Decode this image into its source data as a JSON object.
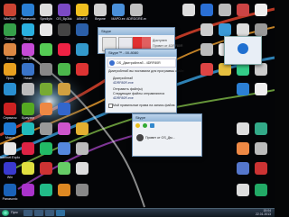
{
  "desktop": {
    "top_labels": [
      "WinRAR",
      "Panasonic",
      "Sprcliyin",
      "OS_Bp3kk",
      "АбЫЕЕ",
      "Внукне",
      "MAPD.ex",
      "ADRDGRE.exe"
    ],
    "left_labels": [
      "Google",
      "Skype",
      "Фото",
      "Camping",
      "Проч",
      "Ниже",
      "Сервисы",
      "Браузер",
      "Мэтот",
      "Internet Explorer",
      "Win",
      "Panasonic"
    ]
  },
  "main_window": {
    "title": "Skype™ - 00-8080",
    "conversation_title": "OS_Дмитрийлтаб - 4DRF80R",
    "line1": "Дмитрийлтаб вы поставили для программы скайп",
    "line2": "Дмитрийлтаб",
    "line3": "4DRF80R.exe",
    "line4": "Отправить файл(ы)",
    "line5": "Следующие файлы отправляются",
    "line6": "4DRF80R.exe",
    "checkbox_label": "Мой правильные права на запись файла"
  },
  "popup_window": {
    "title": "Skype",
    "status": "Доступен",
    "contact": "Привет от 4DRF80R"
  },
  "contact_panel": {
    "title": "Skype",
    "entry": "Привет от OS_Дм..."
  },
  "taskbar": {
    "start_label": "Пуск",
    "clock_time": "15:04",
    "clock_date": "22.01.2013"
  }
}
